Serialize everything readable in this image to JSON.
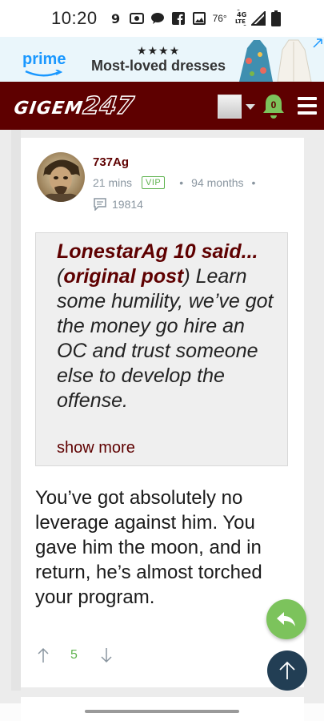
{
  "status_bar": {
    "time": "10:20",
    "temperature": "76°",
    "network": "4G LTE",
    "icons": [
      "nine-icon",
      "camera-icon",
      "chat-bubble-icon",
      "facebook-icon",
      "image-icon",
      "signal-icon",
      "battery-icon"
    ]
  },
  "ad": {
    "brand": "prime",
    "stars": "★★★★",
    "headline": "Most-loved dresses"
  },
  "header": {
    "logo_text": "GIGEM",
    "logo_number": "247",
    "notification_count": "0"
  },
  "post": {
    "username": "737Ag",
    "time_ago": "21 mins",
    "badge": "VIP",
    "membership": "94 months",
    "post_count": "19814",
    "quote": {
      "author": "LonestarAg 10 said...",
      "link_text": "original post",
      "text": " Learn some humility, we’ve got the money go hire an OC and trust someone else to develop the offense.",
      "show_more": "show more"
    },
    "body": "You’ve got absolutely no leverage against him. You gave him the moon, and in return, he’s almost torched your program.",
    "upvotes": "5"
  },
  "colors": {
    "maroon": "#5e0000",
    "vip_green": "#5fb34f",
    "reply_fab": "#7cc35c",
    "top_fab": "#223e54"
  }
}
